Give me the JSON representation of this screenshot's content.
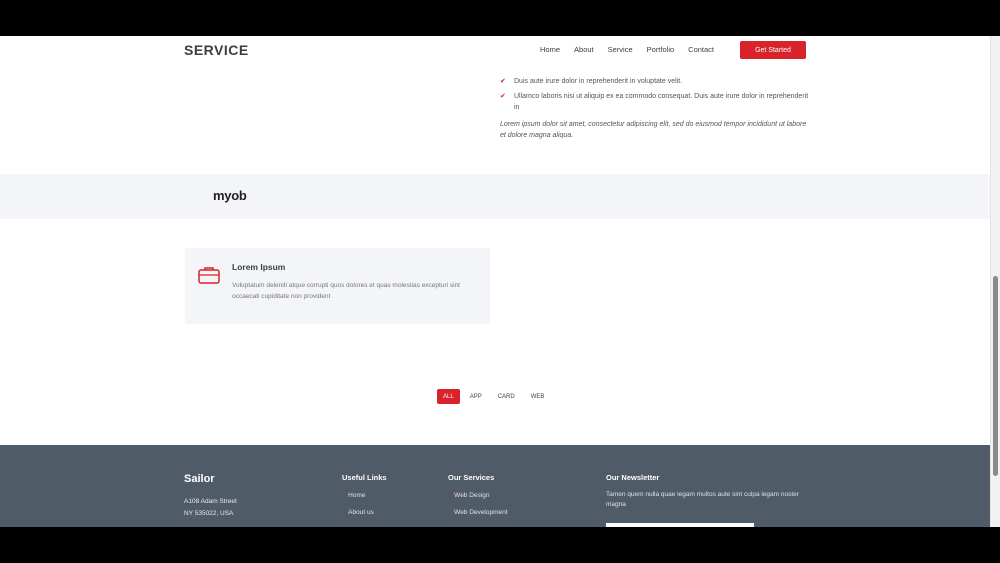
{
  "header": {
    "logo": "SERVICE",
    "nav": [
      "Home",
      "About",
      "Service",
      "Portfolio",
      "Contact"
    ],
    "cta": "Get Started"
  },
  "about": {
    "checks": [
      "Duis aute irure dolor in reprehenderit in voluptate velit.",
      "Ullamco laboris nisi ut aliquip ex ea commodo consequat. Duis aute irure dolor in reprehenderit in"
    ],
    "paragraph": "Lorem ipsum dolor sit amet, consectetur adipiscing elit, sed do eiusmod tempor incididunt ut labore et dolore magna aliqua."
  },
  "clients": {
    "logo": "myob"
  },
  "service_card": {
    "title": "Lorem Ipsum",
    "description": "Voluptatum deleniti atque corrupti quos dolores et quas molestias excepturi sint occaecati cupiditate non provident"
  },
  "portfolio": {
    "filters": [
      "ALL",
      "APP",
      "CARD",
      "WEB"
    ]
  },
  "footer": {
    "brand": "Sailor",
    "address_line1": "A108 Adam Street",
    "address_line2": "NY 535022, USA",
    "useful_links_title": "Useful Links",
    "useful_links": [
      "Home",
      "About us"
    ],
    "services_title": "Our Services",
    "services": [
      "Web Design",
      "Web Development"
    ],
    "newsletter_title": "Our Newsletter",
    "newsletter_text": "Tamen quem nulla quae legam multos aute sint culpa legam noster magna"
  },
  "colors": {
    "accent": "#d8232a",
    "footer_bg": "#4f5b66",
    "band_bg": "#f4f5f8"
  }
}
